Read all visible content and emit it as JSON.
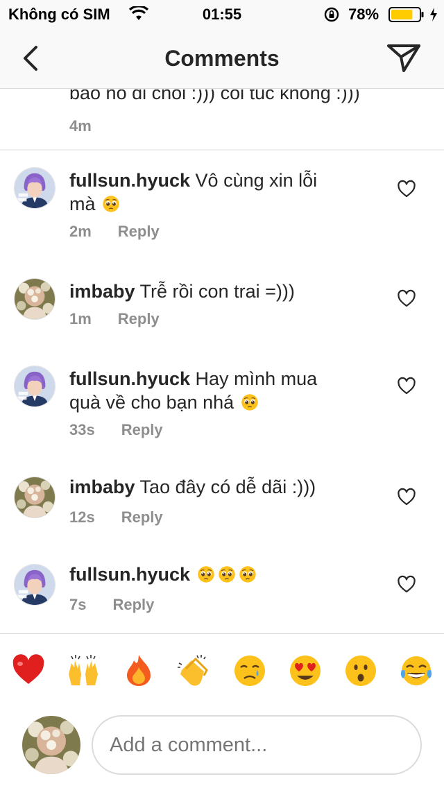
{
  "status_bar": {
    "carrier": "Không có SIM",
    "time": "01:55",
    "battery_percent": "78%",
    "battery_level": 0.78,
    "battery_color": "#ffcc00"
  },
  "nav": {
    "title": "Comments",
    "back_icon": "chevron-left-icon",
    "send_icon": "paper-plane-icon"
  },
  "previous_comment": {
    "text": "bao no di choi :))) coi tuc khong :)))",
    "time": "4m"
  },
  "comments": [
    {
      "user": "fullsun.hyuck",
      "text": "Vô cùng xin lỗi mà",
      "emoji_count": 1,
      "time": "2m",
      "reply_label": "Reply"
    },
    {
      "user": "imbaby",
      "text": "Trễ rồi con trai =)))",
      "emoji_count": 0,
      "time": "1m",
      "reply_label": "Reply"
    },
    {
      "user": "fullsun.hyuck",
      "text": "Hay mình mua quà về cho bạn nhá",
      "emoji_count": 1,
      "time": "33s",
      "reply_label": "Reply"
    },
    {
      "user": "imbaby",
      "text": "Tao đây có dễ dãi :)))",
      "emoji_count": 0,
      "time": "12s",
      "reply_label": "Reply"
    },
    {
      "user": "fullsun.hyuck",
      "text": "",
      "emoji_count": 3,
      "time": "7s",
      "reply_label": "Reply"
    }
  ],
  "reactions": [
    "red-heart",
    "raising-hands",
    "fire",
    "clapping-hands",
    "crying-face",
    "heart-eyes-face",
    "surprised-face",
    "tears-of-joy-face"
  ],
  "composer": {
    "placeholder": "Add a comment..."
  }
}
